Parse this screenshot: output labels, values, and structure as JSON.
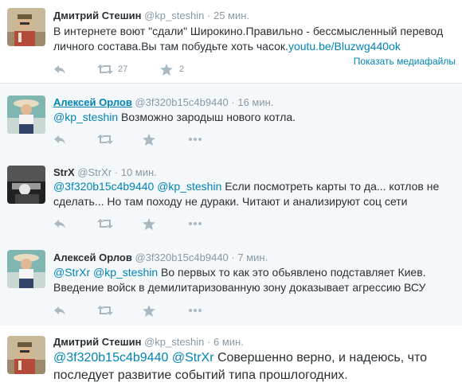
{
  "colors": {
    "link": "#0084b4",
    "text": "#292f33",
    "muted": "#8899a6",
    "highlight": "#f5f8fa"
  },
  "tweets": [
    {
      "name": "Дмитрий Стешин",
      "handle": "@kp_steshin",
      "time": "· 25 мин.",
      "text": "В интернете воют \"сдали\" Широкино.Правильно - бессмысленный перевод личного состава.Вы там побудьте хоть часок.",
      "url": "youtu.be/Bluzwg440ok",
      "media_link": "Показать медиафайлы",
      "retweets": "27",
      "favorites": "2"
    },
    {
      "name": "Алексей Орлов",
      "handle": "@3f320b15c4b9440",
      "time": "· 16 мин.",
      "mention": "@kp_steshin",
      "text": " Возможно зародыш нового котла."
    },
    {
      "name": "StrX",
      "handle": "@StrXr",
      "time": "· 10 мин.",
      "mention1": "@3f320b15c4b9440",
      "mention2": "@kp_steshin",
      "text": " Если посмотреть карты то да... котлов не сделать... Но там походу не дураки. Читают и анализируют соц сети"
    },
    {
      "name": "Алексей Орлов",
      "handle": "@3f320b15c4b9440",
      "time": "· 7 мин.",
      "mention1": "@StrXr",
      "mention2": "@kp_steshin",
      "text": " Во первых то как это обьявлено подставляет Киев. Введение войск в демилитаризованную зону доказывает агрессию ВСУ"
    },
    {
      "name": "Дмитрий Стешин",
      "handle": "@kp_steshin",
      "time": "· 6 мин.",
      "mention1": "@3f320b15c4b9440",
      "mention2": "@StrXr",
      "text": "  Совершенно верно, и надеюсь, что последует развитие событий типа прошлогодних."
    }
  ]
}
